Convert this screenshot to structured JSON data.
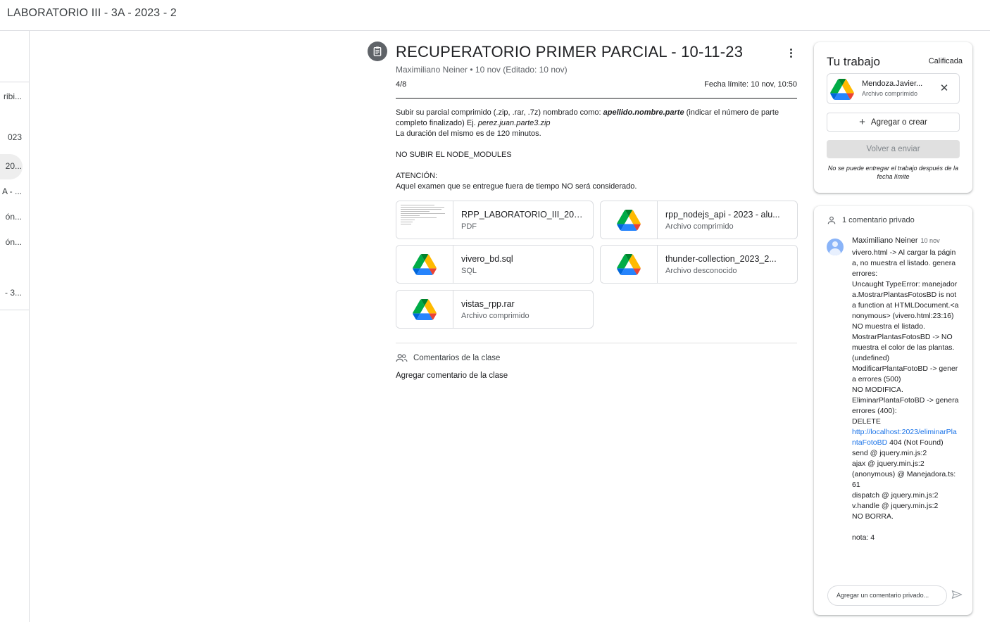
{
  "header": {
    "class_title": "LABORATORIO III - 3A - 2023 - 2"
  },
  "sidebar": {
    "items": [
      {
        "label": "ribi..."
      },
      {
        "label": "023"
      },
      {
        "label": "20..."
      },
      {
        "label": "A - ..."
      },
      {
        "label": "ón..."
      },
      {
        "label": "ón..."
      },
      {
        "label": "- 3..."
      }
    ]
  },
  "assignment": {
    "icon": "assignment-icon",
    "title": "RECUPERATORIO PRIMER PARCIAL - 10-11-23",
    "meta": "Maximiliano Neiner • 10 nov (Editado: 10 nov)",
    "points": "4/8",
    "due": "Fecha límite: 10 nov, 10:50",
    "description": {
      "line1_a": "Subir su parcial comprimido (.zip, .rar, .7z) nombrado como: ",
      "line1_b": "apellido.nombre.parte",
      "line1_c": " (indicar el número de parte",
      "line2_a": "completo finalizado) Ej. ",
      "line2_b": "perez.juan.parte3.zip",
      "line3": "La duración del mismo es de 120 minutos.",
      "line4": "NO SUBIR EL NODE_MODULES",
      "line5": "ATENCIÓN:",
      "line6": "Aquel examen que se entregue fuera de tiempo NO será considerado."
    },
    "attachments": [
      {
        "name": "RPP_LABORATORIO_III_2023...",
        "type": "PDF",
        "icon": "pdf-thumbnail"
      },
      {
        "name": "rpp_nodejs_api - 2023 - alu...",
        "type": "Archivo comprimido",
        "icon": "google-drive-icon"
      },
      {
        "name": "vivero_bd.sql",
        "type": "SQL",
        "icon": "google-drive-icon"
      },
      {
        "name": "thunder-collection_2023_2...",
        "type": "Archivo desconocido",
        "icon": "google-drive-icon"
      },
      {
        "name": "vistas_rpp.rar",
        "type": "Archivo comprimido",
        "icon": "google-drive-icon"
      }
    ],
    "class_comments": {
      "heading": "Comentarios de la clase",
      "add": "Agregar comentario de la clase"
    }
  },
  "your_work": {
    "title": "Tu trabajo",
    "status": "Calificada",
    "file": {
      "name": "Mendoza.Javier...",
      "type": "Archivo comprimido"
    },
    "add_button": "Agregar o crear",
    "resubmit_button": "Volver a enviar",
    "note": "No se puede entregar el trabajo después de la fecha límite"
  },
  "private_comments": {
    "heading": "1 comentario privado",
    "author": "Maximiliano Neiner",
    "date": "10 nov",
    "lines": [
      "vivero.html -> Al cargar la página, no muestra el listado. genera errores:",
      "Uncaught TypeError: manejadora.MostrarPlantasFotosBD is not a function at HTMLDocument.<anonymous> (vivero.html:23:16)",
      "NO muestra el listado.",
      "MostrarPlantasFotosBD -> NO muestra el color de las plantas. (undefined)",
      "ModificarPlantaFotoBD -> genera errores (500)",
      "NO MODIFICA.",
      "EliminarPlantaFotoBD -> genera errores (400):",
      "DELETE"
    ],
    "link": "http://localhost:2023/eliminarPlantaFotoBD",
    "after_link": " 404 (Not Found)",
    "lines2": [
      "send @ jquery.min.js:2",
      "ajax @ jquery.min.js:2",
      "(anonymous) @ Manejadora.ts:61",
      "dispatch @ jquery.min.js:2",
      "v.handle @ jquery.min.js:2",
      "NO BORRA."
    ],
    "grade": "nota: 4",
    "input_placeholder": "Agregar un comentario privado..."
  }
}
